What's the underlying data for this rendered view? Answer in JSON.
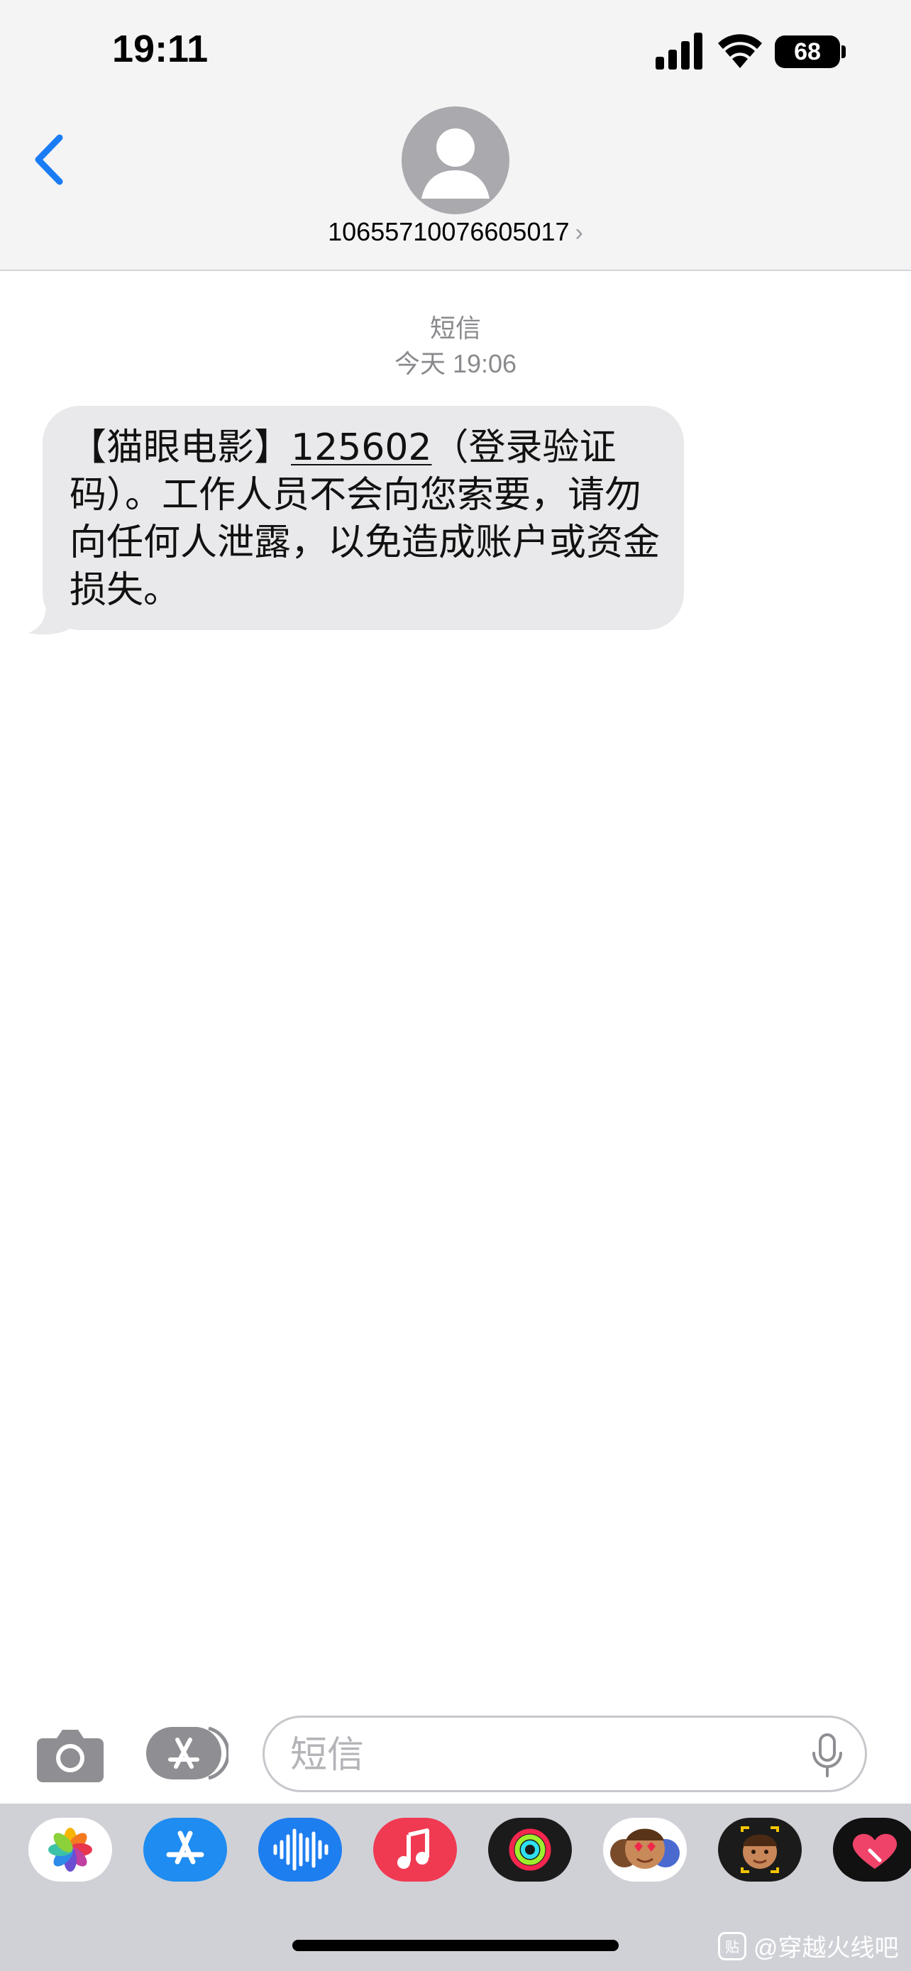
{
  "status_bar": {
    "time": "19:11",
    "battery": "68",
    "icons": [
      "cellular-signal-icon",
      "wifi-icon",
      "battery-icon"
    ]
  },
  "header": {
    "back_icon": "chevron-left-icon",
    "avatar_icon": "person-icon",
    "contact_number": "10655710076605017",
    "detail_chevron": "›"
  },
  "thread": {
    "service_type": "短信",
    "timestamp": "今天 19:06"
  },
  "message": {
    "prefix": "【猫眼电影】",
    "code": "125602",
    "body": "（登录验证码）。工作人员不会向您索要，请勿向任何人泄露，以免造成账户或资金损失。"
  },
  "input_bar": {
    "placeholder": "短信",
    "value": "",
    "icons": [
      "camera-icon",
      "app-store-icon",
      "microphone-icon"
    ]
  },
  "app_strip": {
    "apps": [
      "photos-app-icon",
      "app-store-app-icon",
      "audio-messages-app-icon",
      "music-app-icon",
      "fitness-app-icon",
      "memoji-stickers-app-icon",
      "memoji-app-icon",
      "digital-touch-app-icon"
    ]
  },
  "watermark": {
    "text": "@穿越火线吧",
    "logo": "贴"
  },
  "colors": {
    "accent_blue": "#1a7cf5",
    "bubble_gray": "#e9e9eb",
    "header_bg": "#f4f4f5"
  }
}
